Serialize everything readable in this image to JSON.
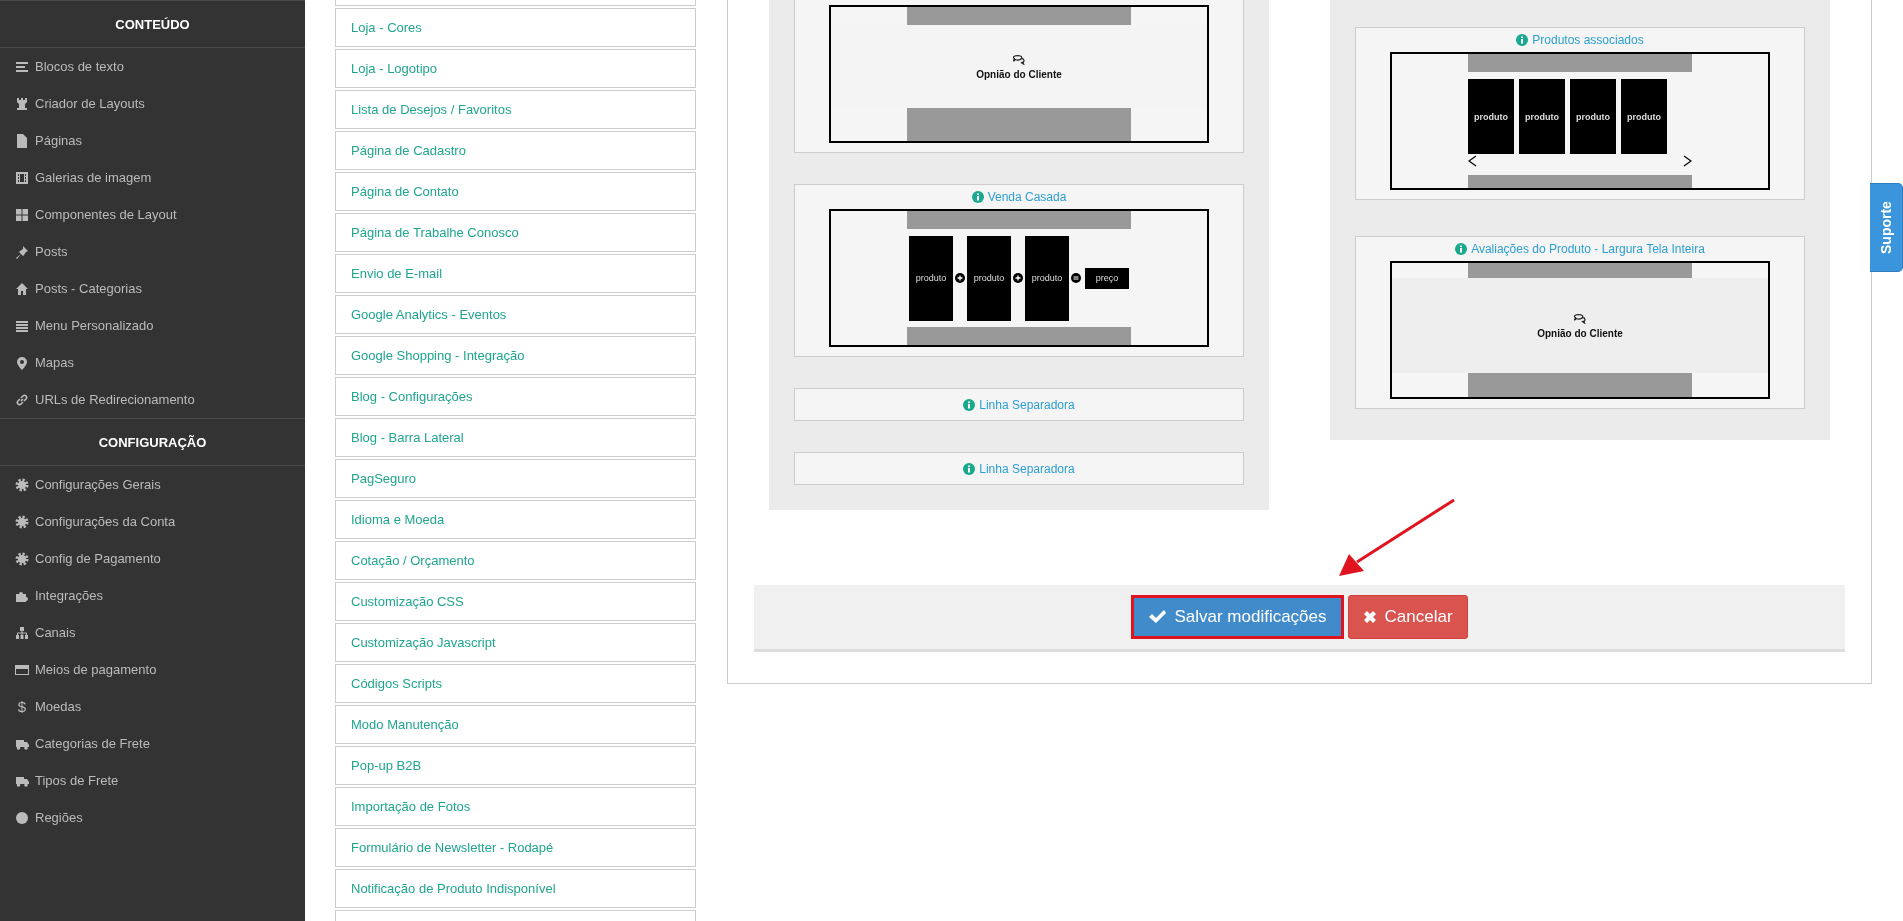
{
  "sidebar": {
    "sections": [
      {
        "title": "CONTEÚDO",
        "items": [
          {
            "label": "Blocos de texto"
          },
          {
            "label": "Criador de Layouts"
          },
          {
            "label": "Páginas"
          },
          {
            "label": "Galerias de imagem"
          },
          {
            "label": "Componentes de Layout"
          },
          {
            "label": "Posts"
          },
          {
            "label": "Posts - Categorias"
          },
          {
            "label": "Menu Personalizado"
          },
          {
            "label": "Mapas"
          },
          {
            "label": "URLs de Redirecionamento"
          }
        ]
      },
      {
        "title": "CONFIGURAÇÃO",
        "items": [
          {
            "label": "Configurações Gerais"
          },
          {
            "label": "Configurações da Conta"
          },
          {
            "label": "Config de Pagamento"
          },
          {
            "label": "Integrações"
          },
          {
            "label": "Canais"
          },
          {
            "label": "Meios de pagamento"
          },
          {
            "label": "Moedas",
            "glyph": "$"
          },
          {
            "label": "Categorias de Frete"
          },
          {
            "label": "Tipos de Frete"
          },
          {
            "label": "Regiões"
          }
        ]
      }
    ]
  },
  "settings_list": {
    "items": [
      "Loja - Cores",
      "Loja - Logotipo",
      "Lista de Desejos / Favoritos",
      "Página de Cadastro",
      "Página de Contato",
      "Página de Trabalhe Conosco",
      "Envio de E-mail",
      "Google Analytics - Eventos",
      "Google Shopping - Integração",
      "Blog - Configurações",
      "Blog - Barra Lateral",
      "PagSeguro",
      "Idioma e Moeda",
      "Cotação / Orçamento",
      "Customização CSS",
      "Customização Javascript",
      "Códigos Scripts",
      "Modo Manutenção",
      "Pop-up B2B",
      "Importação de Fotos",
      "Formulário de Newsletter - Rodapé",
      "Notificação de Produto Indisponível"
    ]
  },
  "layout_editor": {
    "columns": [
      {
        "blocks": [
          {
            "kind": "reviews",
            "caption": "Opnião do Cliente",
            "full_width": false
          },
          {
            "kind": "combo",
            "title": "Venda Casada",
            "products": [
              "produto",
              "produto",
              "produto"
            ],
            "price": "preço"
          },
          {
            "kind": "separator",
            "title": "Linha Separadora"
          },
          {
            "kind": "separator",
            "title": "Linha Separadora"
          }
        ]
      },
      {
        "blocks": [
          {
            "kind": "carousel",
            "title": "Produtos associados",
            "products": [
              "produto",
              "produto",
              "produto",
              "produto"
            ]
          },
          {
            "kind": "reviews",
            "title": "Avaliações do Produto - Largura Tela Inteira",
            "caption": "Opnião do Cliente",
            "full_width": true
          }
        ]
      }
    ]
  },
  "actions": [
    {
      "kind": "save",
      "label": "Salvar modificações",
      "highlighted": true
    },
    {
      "kind": "cancel",
      "label": "Cancelar",
      "highlighted": false
    }
  ],
  "support_tab": {
    "label": "Suporte"
  }
}
